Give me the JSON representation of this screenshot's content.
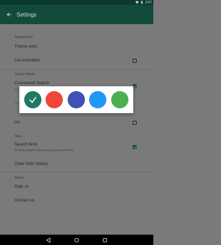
{
  "status_bar": {
    "time": "2:07"
  },
  "toolbar": {
    "title": "Settings"
  },
  "sections": {
    "appearance": "Appearance",
    "search_mode": "Search Mode",
    "hints": "hints",
    "about": "About"
  },
  "items": {
    "theme_color": "Theme color",
    "list_animation": "List animation",
    "concurrent_search": "Concurrent Search",
    "concurrent_search_sub": "Concurrent search between all providers",
    "hidden_sub_label": "Search with",
    "hidden_row_label": "Ho",
    "search_hints": "Search hints",
    "search_hints_sub": "Provide search hints storing queries history",
    "clear_hints": "Clear hints history",
    "rate_us": "Rate us",
    "contact_us": "Contact us"
  },
  "checkboxes": {
    "list_animation": false,
    "concurrent_search": true,
    "hidden_row": false,
    "search_hints": true
  },
  "color_picker": {
    "selected": "teal",
    "colors": [
      "#1f7a63",
      "#ef453a",
      "#3f51b5",
      "#2196f3",
      "#4caf50"
    ]
  },
  "icons": {
    "back": "arrow-left-icon",
    "wifi": "wifi-icon",
    "battery": "battery-icon",
    "nav_back": "nav-back-icon",
    "nav_home": "nav-home-icon",
    "nav_recents": "nav-recents-icon"
  }
}
